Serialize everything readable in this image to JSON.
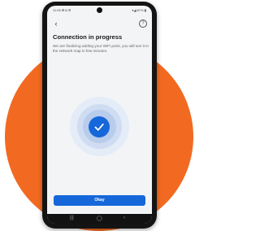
{
  "colors": {
    "accent": "#1667d9",
    "background_circle": "#f26a21",
    "phone_body": "#141414",
    "screen_bg": "#f3f4f6"
  },
  "status_bar": {
    "time": "11:05",
    "indicators": "⊞ ◘ ⚙",
    "signal": "▾◢ 87% ▮"
  },
  "header": {
    "back_icon": "chevron-left-icon",
    "back_glyph": "‹",
    "help_icon": "help-circle-icon",
    "help_glyph": "?"
  },
  "content": {
    "title": "Connection in progress",
    "description": "We are finalizing adding your WiFi point, you will see it in the network map in few minutes."
  },
  "status_icon": "checkmark-icon",
  "button": {
    "label": "Okay"
  },
  "nav_bar": {
    "recents": "|||",
    "home": "◯",
    "back": "‹"
  }
}
